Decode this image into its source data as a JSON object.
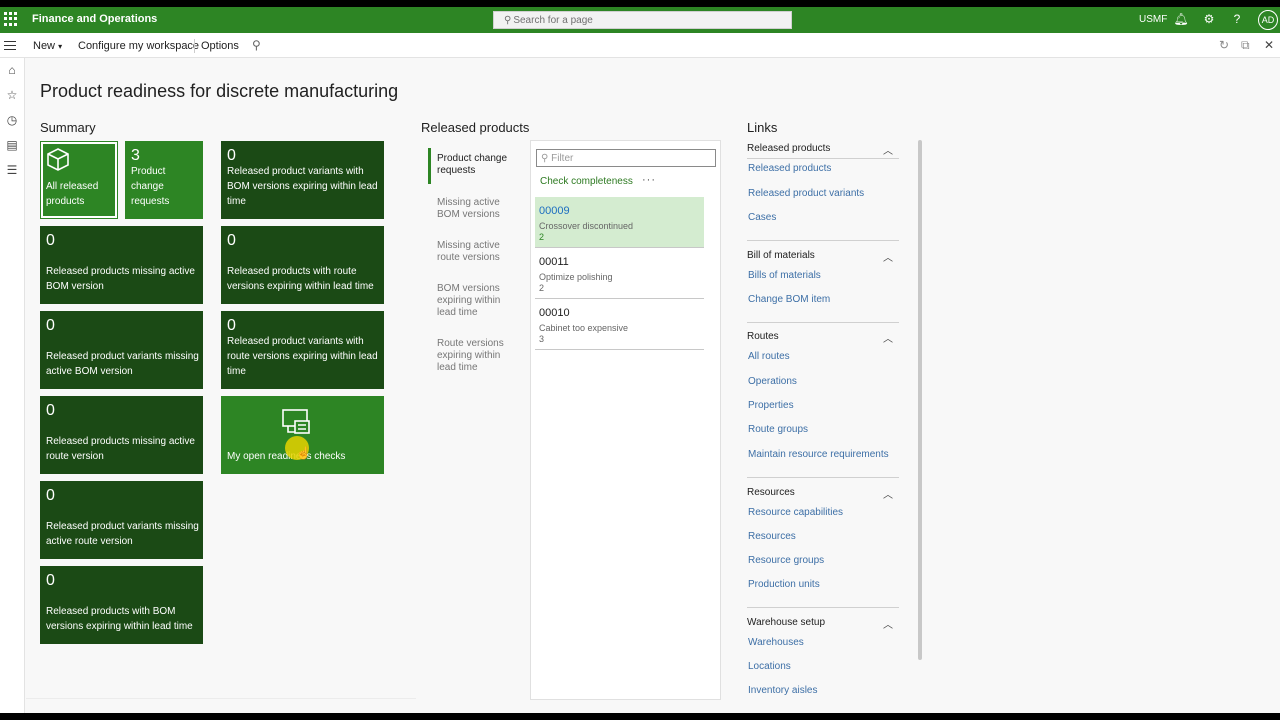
{
  "topbar": {
    "app_title": "Finance and Operations",
    "search_placeholder": "Search for a page",
    "company": "USMF",
    "avatar_initials": "AD",
    "accent": "#2d8524"
  },
  "actionbar": {
    "new_label": "New",
    "configure_label": "Configure my workspace",
    "options_label": "Options"
  },
  "page": {
    "title": "Product readiness for discrete manufacturing"
  },
  "summary": {
    "title": "Summary",
    "tiles": [
      {
        "count": "",
        "label": "All released products"
      },
      {
        "count": "3",
        "label": "Product change requests"
      },
      {
        "count": "0",
        "label": "Released product variants with BOM versions expiring within lead time"
      },
      {
        "count": "0",
        "label": "Released products missing active BOM version"
      },
      {
        "count": "0",
        "label": "Released products with route versions expiring within lead time"
      },
      {
        "count": "0",
        "label": "Released product variants missing active BOM version"
      },
      {
        "count": "0",
        "label": "Released product variants with route versions expiring within lead time"
      },
      {
        "count": "0",
        "label": "Released products missing active route version"
      },
      {
        "count": "",
        "label": "My open readiness checks"
      },
      {
        "count": "0",
        "label": "Released product variants missing active route version"
      },
      {
        "count": "0",
        "label": "Released products with BOM versions expiring within lead time"
      }
    ]
  },
  "released": {
    "title": "Released products",
    "tabs": [
      "Product change requests",
      "Missing active BOM versions",
      "Missing active route versions",
      "BOM versions expiring within lead time",
      "Route versions expiring within lead time"
    ],
    "filter_placeholder": "Filter",
    "check_completeness": "Check completeness",
    "more": "···",
    "cards": [
      {
        "id": "00009",
        "desc": "Crossover discontinued",
        "num": "2"
      },
      {
        "id": "00011",
        "desc": "Optimize polishing",
        "num": "2"
      },
      {
        "id": "00010",
        "desc": "Cabinet too expensive",
        "num": "3"
      }
    ]
  },
  "links": {
    "title": "Links",
    "groups": [
      {
        "title": "Released products",
        "items": [
          "Released products",
          "Released product variants",
          "Cases"
        ]
      },
      {
        "title": "Bill of materials",
        "items": [
          "Bills of materials",
          "Change BOM item"
        ]
      },
      {
        "title": "Routes",
        "items": [
          "All routes",
          "Operations",
          "Properties",
          "Route groups",
          "Maintain resource requirements"
        ]
      },
      {
        "title": "Resources",
        "items": [
          "Resource capabilities",
          "Resources",
          "Resource groups",
          "Production units"
        ]
      },
      {
        "title": "Warehouse setup",
        "items": [
          "Warehouses",
          "Locations",
          "Inventory aisles"
        ]
      }
    ]
  }
}
